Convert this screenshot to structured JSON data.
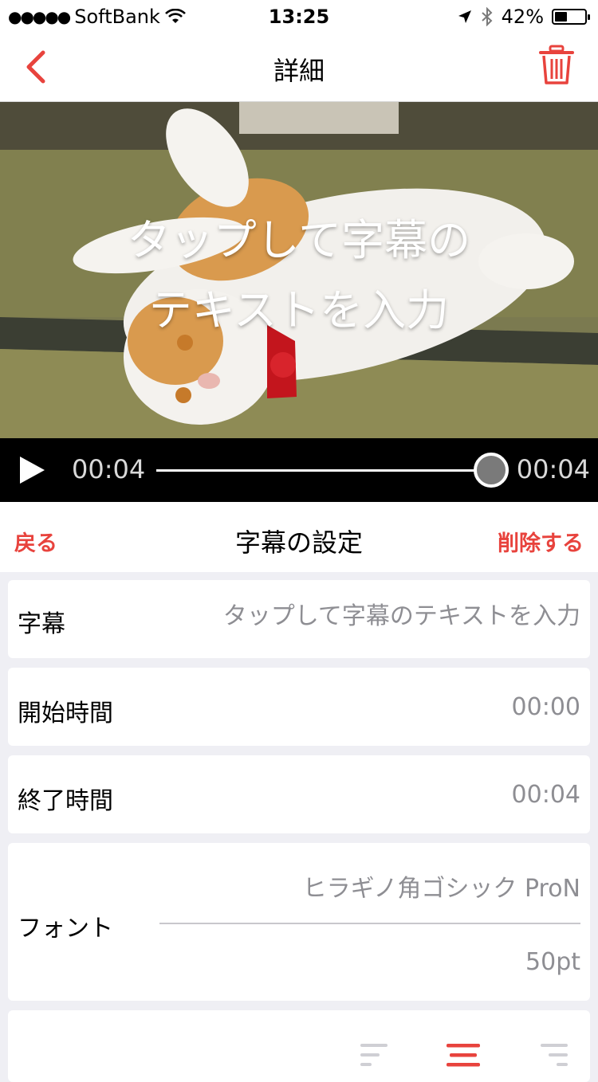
{
  "status_bar": {
    "carrier": "SoftBank",
    "time": "13:25",
    "battery_percent": "42%",
    "battery_level": 0.42
  },
  "nav": {
    "title": "詳細"
  },
  "video": {
    "caption_line1": "タップして字幕の",
    "caption_line2": "テキストを入力"
  },
  "player": {
    "current_time": "00:04",
    "duration": "00:04",
    "progress": 1.0
  },
  "settings": {
    "back_label": "戻る",
    "heading": "字幕の設定",
    "delete_label": "削除する",
    "subtitle": {
      "label": "字幕",
      "placeholder": "タップして字幕のテキストを入力"
    },
    "start_time": {
      "label": "開始時間",
      "value": "00:00"
    },
    "end_time": {
      "label": "終了時間",
      "value": "00:04"
    },
    "font": {
      "label": "フォント",
      "family": "ヒラギノ角ゴシック ProN",
      "size": "50pt"
    },
    "alignment": {
      "options": [
        "left",
        "center",
        "right"
      ],
      "selected": "center"
    }
  },
  "colors": {
    "accent": "#e8433d",
    "secondary_text": "#8e8e93",
    "background": "#efeff4"
  }
}
